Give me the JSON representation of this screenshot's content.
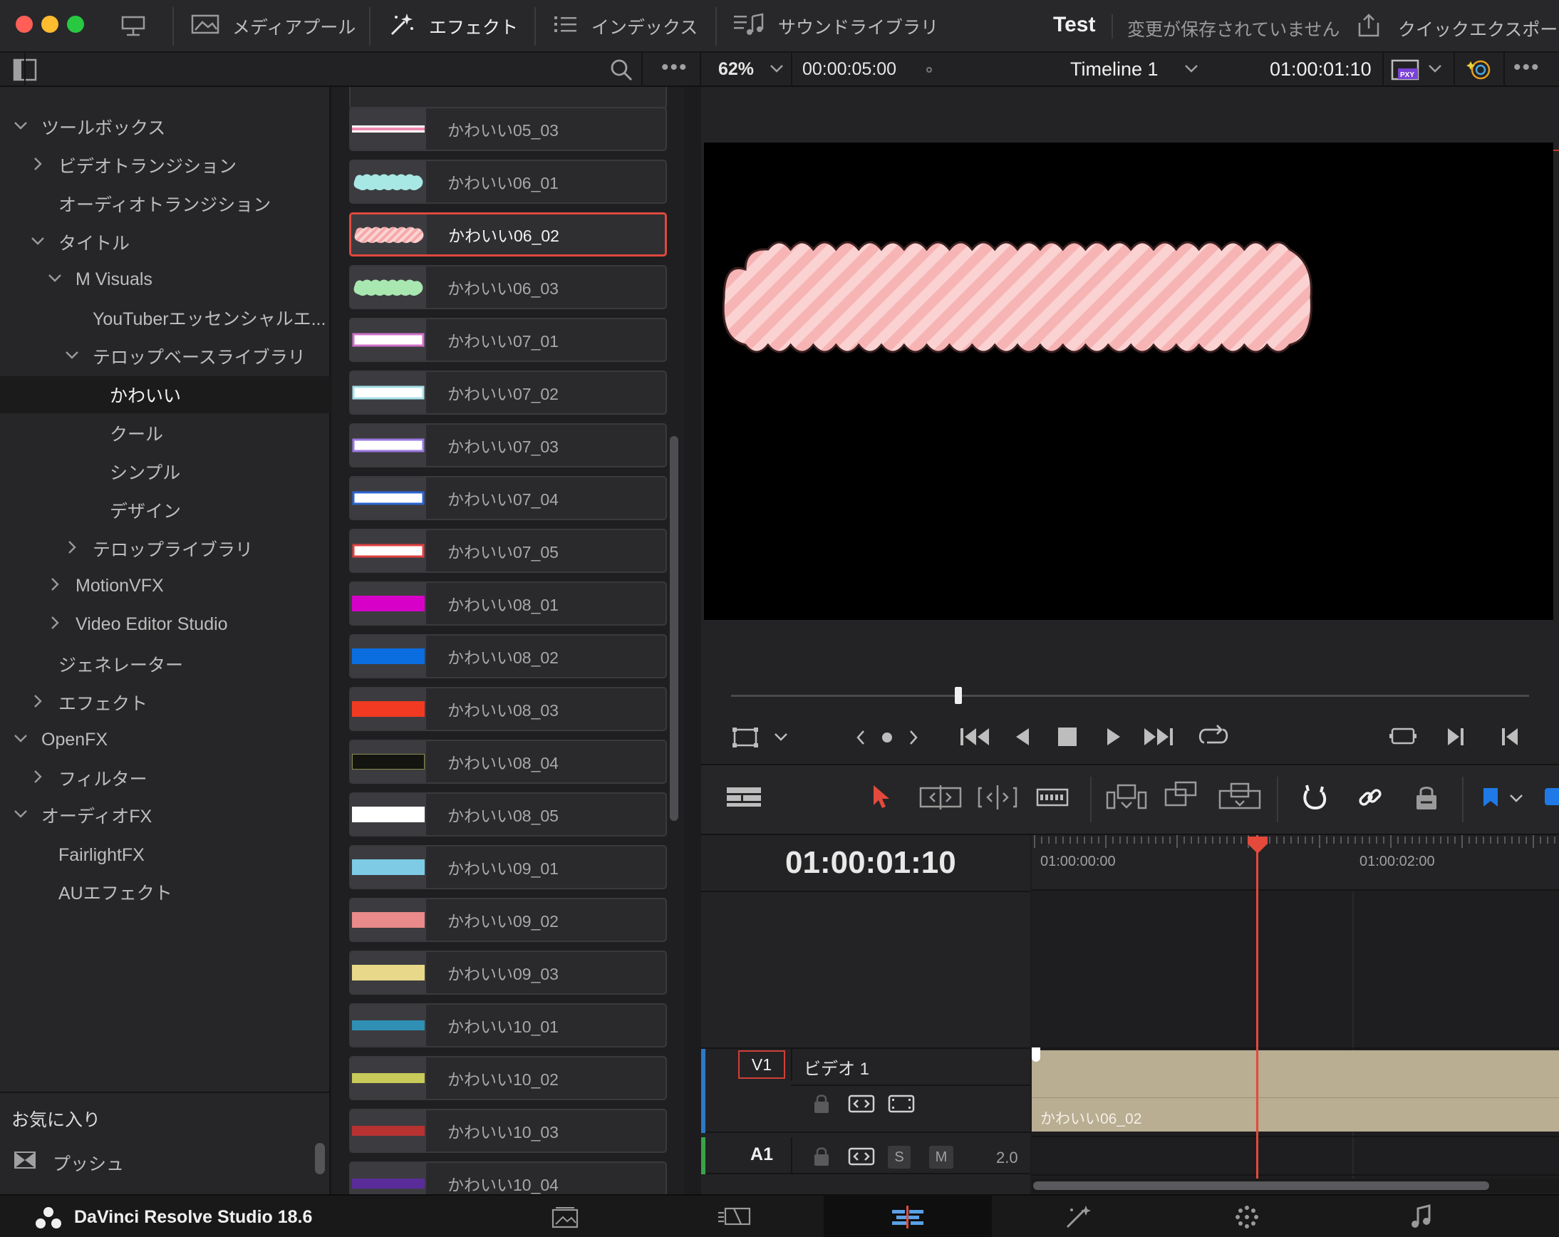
{
  "topbar": {
    "tabs": [
      {
        "label": "メディアプール",
        "icon": "media-pool-icon"
      },
      {
        "label": "エフェクト",
        "icon": "effects-wand-icon"
      },
      {
        "label": "インデックス",
        "icon": "index-list-icon"
      },
      {
        "label": "サウンドライブラリ",
        "icon": "sound-library-icon"
      }
    ],
    "project_name": "Test",
    "save_status": "変更が保存されていません",
    "quick_export": "クイックエクスポート"
  },
  "viewer_bar": {
    "zoom": "62%",
    "duration": "00:00:05:00",
    "timeline_name": "Timeline 1",
    "timecode": "01:00:01:10"
  },
  "tree": {
    "items": [
      {
        "label": "ツールボックス",
        "chevron": "down"
      },
      {
        "label": "ビデオトランジション",
        "chevron": "right"
      },
      {
        "label": "オーディオトランジション",
        "chevron": ""
      },
      {
        "label": "タイトル",
        "chevron": "down"
      },
      {
        "label": "M Visuals",
        "chevron": "down"
      },
      {
        "label": "YouTuberエッセンシャルエ...",
        "chevron": ""
      },
      {
        "label": "テロップベースライブラリ",
        "chevron": "down"
      },
      {
        "label": "かわいい",
        "chevron": ""
      },
      {
        "label": "クール",
        "chevron": ""
      },
      {
        "label": "シンプル",
        "chevron": ""
      },
      {
        "label": "デザイン",
        "chevron": ""
      },
      {
        "label": "テロップライブラリ",
        "chevron": "right"
      },
      {
        "label": "MotionVFX",
        "chevron": "right"
      },
      {
        "label": "Video Editor Studio",
        "chevron": "right"
      },
      {
        "label": "ジェネレーター",
        "chevron": ""
      },
      {
        "label": "エフェクト",
        "chevron": "right"
      },
      {
        "label": "OpenFX",
        "chevron": "down"
      },
      {
        "label": "フィルター",
        "chevron": "right"
      },
      {
        "label": "オーディオFX",
        "chevron": "down"
      },
      {
        "label": "FairlightFX",
        "chevron": ""
      },
      {
        "label": "AUエフェクト",
        "chevron": ""
      }
    ],
    "favorites_label": "お気に入り",
    "favorites_items": [
      {
        "label": "プッシュ"
      }
    ]
  },
  "effects_list": {
    "items": [
      {
        "label": "かわいい05_03",
        "color": "#f4c6d2"
      },
      {
        "label": "かわいい06_01",
        "color": "#a8e8e4"
      },
      {
        "label": "かわいい06_02",
        "color": "#f6a8a8"
      },
      {
        "label": "かわいい06_03",
        "color": "#a8e8b0"
      },
      {
        "label": "かわいい07_01",
        "color": "#ffffff"
      },
      {
        "label": "かわいい07_02",
        "color": "#ffffff"
      },
      {
        "label": "かわいい07_03",
        "color": "#ffffff"
      },
      {
        "label": "かわいい07_04",
        "color": "#ffffff"
      },
      {
        "label": "かわいい07_05",
        "color": "#ffffff"
      },
      {
        "label": "かわいい08_01",
        "color": "#d600c8"
      },
      {
        "label": "かわいい08_02",
        "color": "#0a6ee0"
      },
      {
        "label": "かわいい08_03",
        "color": "#f23a22"
      },
      {
        "label": "かわいい08_04",
        "color": "#141410"
      },
      {
        "label": "かわいい08_05",
        "color": "#ffffff"
      },
      {
        "label": "かわいい09_01",
        "color": "#7ecbe6"
      },
      {
        "label": "かわいい09_02",
        "color": "#ea8a8a"
      },
      {
        "label": "かわいい09_03",
        "color": "#e8d98a"
      },
      {
        "label": "かわいい10_01",
        "color": "#2f8fb4"
      },
      {
        "label": "かわいい10_02",
        "color": "#c8ca5a"
      },
      {
        "label": "かわいい10_03",
        "color": "#b83232"
      },
      {
        "label": "かわいい10_04",
        "color": "#5a2c9a"
      }
    ]
  },
  "timeline": {
    "timecode": "01:00:01:10",
    "ruler": [
      "01:00:00:00",
      "01:00:02:00"
    ],
    "video_track": {
      "id": "V1",
      "name": "ビデオ 1"
    },
    "audio_track": {
      "id": "A1",
      "solo": "S",
      "mute": "M",
      "channels": "2.0"
    },
    "clip_label": "かわいい06_02"
  },
  "bottombar": {
    "app_name": "DaVinci Resolve Studio 18.6"
  }
}
